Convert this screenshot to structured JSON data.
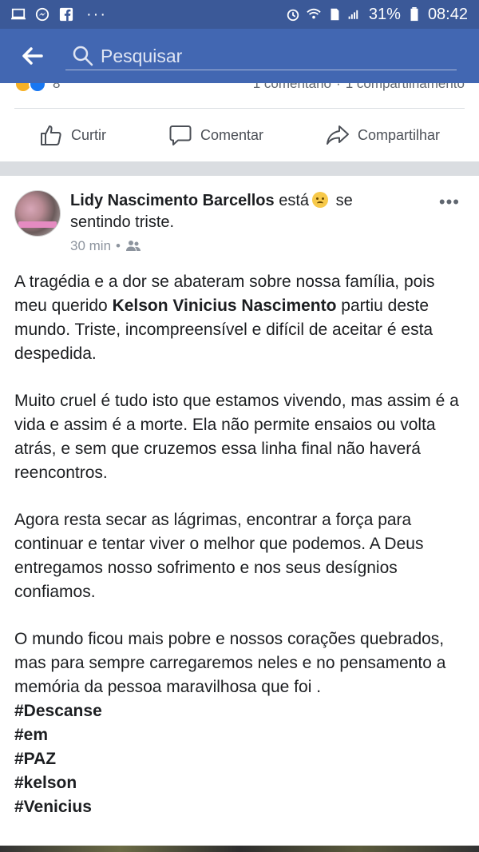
{
  "status_bar": {
    "battery": "31%",
    "time": "08:42",
    "icons": [
      "monitor-icon",
      "messenger-icon",
      "facebook-icon",
      "more-dots-icon",
      "alarm-icon",
      "wifi-icon",
      "sim-icon",
      "signal-icon",
      "battery-icon"
    ]
  },
  "header": {
    "search_placeholder": "Pesquisar",
    "bg_color": "#4267b2"
  },
  "summary": {
    "reaction_count": "8",
    "comments": "1 comentário",
    "separator": "·",
    "shares": "1 compartilhamento"
  },
  "actions": {
    "like": "Curtir",
    "comment": "Comentar",
    "share": "Compartilhar"
  },
  "post": {
    "author": "Lidy Nascimento Barcellos",
    "feeling_prefix": "está",
    "feeling_suffix": "se sentindo triste.",
    "time": "30 min",
    "dot": "•",
    "more": "•••",
    "paragraph1_pre": "A tragédia e a dor se abateram sobre nossa família, pois meu querido ",
    "mention": "Kelson Vinicius Nascimento",
    "paragraph1_post": " partiu deste mundo. Triste, incompreensível e difícil de aceitar é esta despedida.",
    "paragraph2": "Muito cruel é tudo isto que estamos vivendo, mas assim é a vida e assim é a morte. Ela não permite ensaios ou volta atrás, e sem que cruzemos essa linha final não haverá reencontros.",
    "paragraph3": "Agora resta secar as lágrimas, encontrar a força para continuar e tentar viver o melhor que podemos. A Deus entregamos nosso sofrimento e nos seus desígnios confiamos.",
    "paragraph4": "O mundo ficou mais pobre e nossos corações quebrados, mas para sempre carregaremos neles e no pensamento a memória da pessoa maravilhosa que foi .",
    "hashtags": [
      "#Descanse",
      "#em",
      "#PAZ",
      "#kelson",
      "#Venicius"
    ]
  }
}
